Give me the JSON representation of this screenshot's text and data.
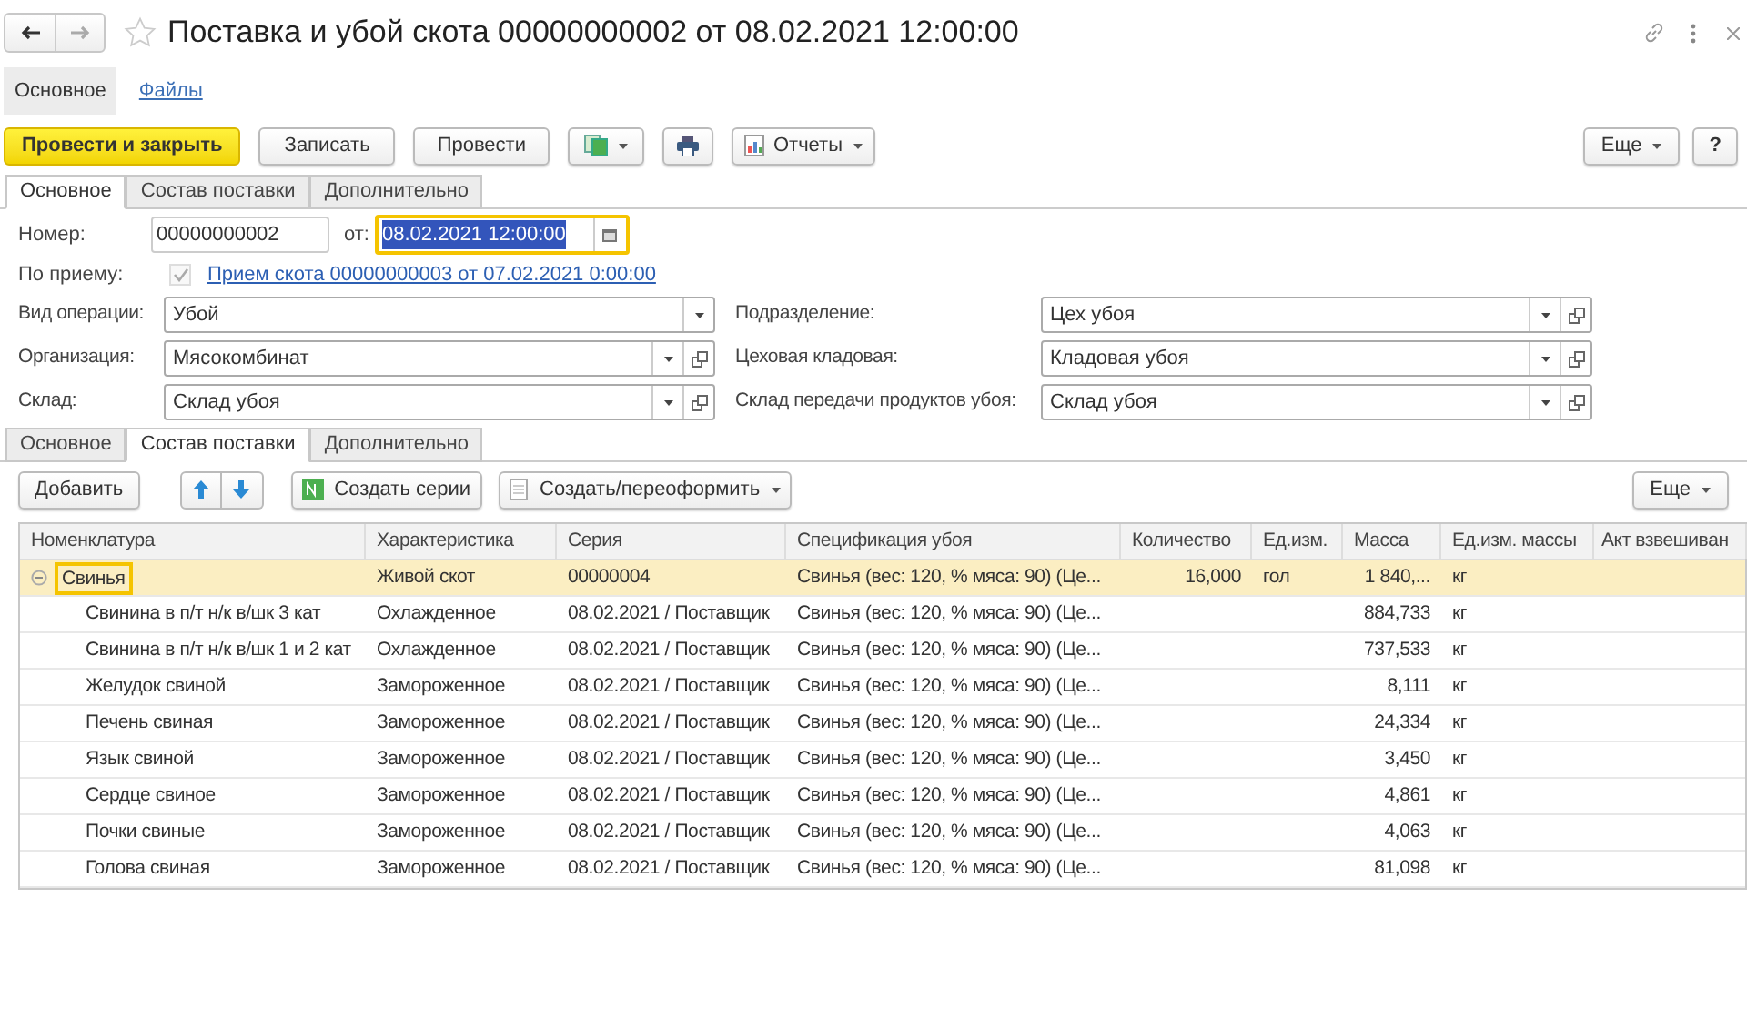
{
  "window": {
    "title": "Поставка и убой скота 00000000002 от 08.02.2021 12:00:00",
    "favorite": false
  },
  "form_tabs": [
    {
      "label": "Основное",
      "selected": true
    },
    {
      "label": "Файлы",
      "selected": false
    }
  ],
  "toolbar": {
    "post_close": "Провести и закрыть",
    "save": "Записать",
    "post": "Провести",
    "reports": "Отчеты",
    "more": "Еще",
    "help": "?"
  },
  "page_tabs": [
    {
      "label": "Основное",
      "selected": true
    },
    {
      "label": "Состав поставки",
      "selected": false
    },
    {
      "label": "Дополнительно",
      "selected": false
    }
  ],
  "header": {
    "number_label": "Номер:",
    "number": "00000000002",
    "date_label": "от:",
    "date": "08.02.2021 12:00:00",
    "receipt_label": "По приему:",
    "receipt_checked": true,
    "receipt_link": "Прием скота 00000000003 от 07.02.2021 0:00:00",
    "left_fields": [
      {
        "label": "Вид операции:",
        "value": "Убой",
        "open": false
      },
      {
        "label": "Организация:",
        "value": "Мясокомбинат",
        "open": true
      },
      {
        "label": "Склад:",
        "value": "Склад убоя",
        "open": true
      }
    ],
    "right_fields": [
      {
        "label": "Подразделение:",
        "value": "Цех убоя",
        "open": true
      },
      {
        "label": "Цеховая кладовая:",
        "value": "Кладовая убоя",
        "open": true
      },
      {
        "label": "Склад передачи продуктов убоя:",
        "value": "Склад убоя",
        "open": true
      }
    ]
  },
  "lower_tabs": [
    {
      "label": "Основное",
      "selected": false
    },
    {
      "label": "Состав поставки",
      "selected": true
    },
    {
      "label": "Дополнительно",
      "selected": false
    }
  ],
  "table_toolbar": {
    "add": "Добавить",
    "create_series": "Создать серии",
    "create_reform": "Создать/переоформить",
    "more": "Еще"
  },
  "table": {
    "columns": [
      "Номенклатура",
      "Характеристика",
      "Серия",
      "Спецификация убоя",
      "Количество",
      "Ед.изм.",
      "Масса",
      "Ед.изм. массы",
      "Акт взвешиван"
    ],
    "rows": [
      {
        "cells": [
          "Свинья",
          "Живой скот",
          "00000004",
          "Свинья (вес: 120, % мяса: 90) (Це...",
          "16,000",
          "гол",
          "1 840,...",
          "кг",
          ""
        ],
        "selected": true,
        "expanded": true,
        "children": [
          {
            "cells": [
              "Свинина в п/т н/к в/шк 3 кат",
              "Охлажденное",
              "08.02.2021 / Поставщик",
              "Свинья (вес: 120, % мяса: 90) (Це...",
              "",
              "",
              "884,733",
              "кг",
              ""
            ],
            "selected": false
          },
          {
            "cells": [
              "Свинина в п/т н/к в/шк 1 и 2 кат",
              "Охлажденное",
              "08.02.2021 / Поставщик",
              "Свинья (вес: 120, % мяса: 90) (Це...",
              "",
              "",
              "737,533",
              "кг",
              ""
            ],
            "selected": false
          },
          {
            "cells": [
              "Желудок свиной",
              "Замороженное",
              "08.02.2021 / Поставщик",
              "Свинья (вес: 120, % мяса: 90) (Це...",
              "",
              "",
              "8,111",
              "кг",
              ""
            ],
            "selected": false
          },
          {
            "cells": [
              "Печень свиная",
              "Замороженное",
              "08.02.2021 / Поставщик",
              "Свинья (вес: 120, % мяса: 90) (Це...",
              "",
              "",
              "24,334",
              "кг",
              ""
            ],
            "selected": false
          },
          {
            "cells": [
              "Язык свиной",
              "Замороженное",
              "08.02.2021 / Поставщик",
              "Свинья (вес: 120, % мяса: 90) (Це...",
              "",
              "",
              "3,450",
              "кг",
              ""
            ],
            "selected": false
          },
          {
            "cells": [
              "Сердце свиное",
              "Замороженное",
              "08.02.2021 / Поставщик",
              "Свинья (вес: 120, % мяса: 90) (Це...",
              "",
              "",
              "4,861",
              "кг",
              ""
            ],
            "selected": false
          },
          {
            "cells": [
              "Почки свиные",
              "Замороженное",
              "08.02.2021 / Поставщик",
              "Свинья (вес: 120, % мяса: 90) (Це...",
              "",
              "",
              "4,063",
              "кг",
              ""
            ],
            "selected": false
          },
          {
            "cells": [
              "Голова свиная",
              "Замороженное",
              "08.02.2021 / Поставщик",
              "Свинья (вес: 120, % мяса: 90) (Це...",
              "",
              "",
              "81,098",
              "кг",
              ""
            ],
            "selected": false
          }
        ]
      }
    ]
  }
}
